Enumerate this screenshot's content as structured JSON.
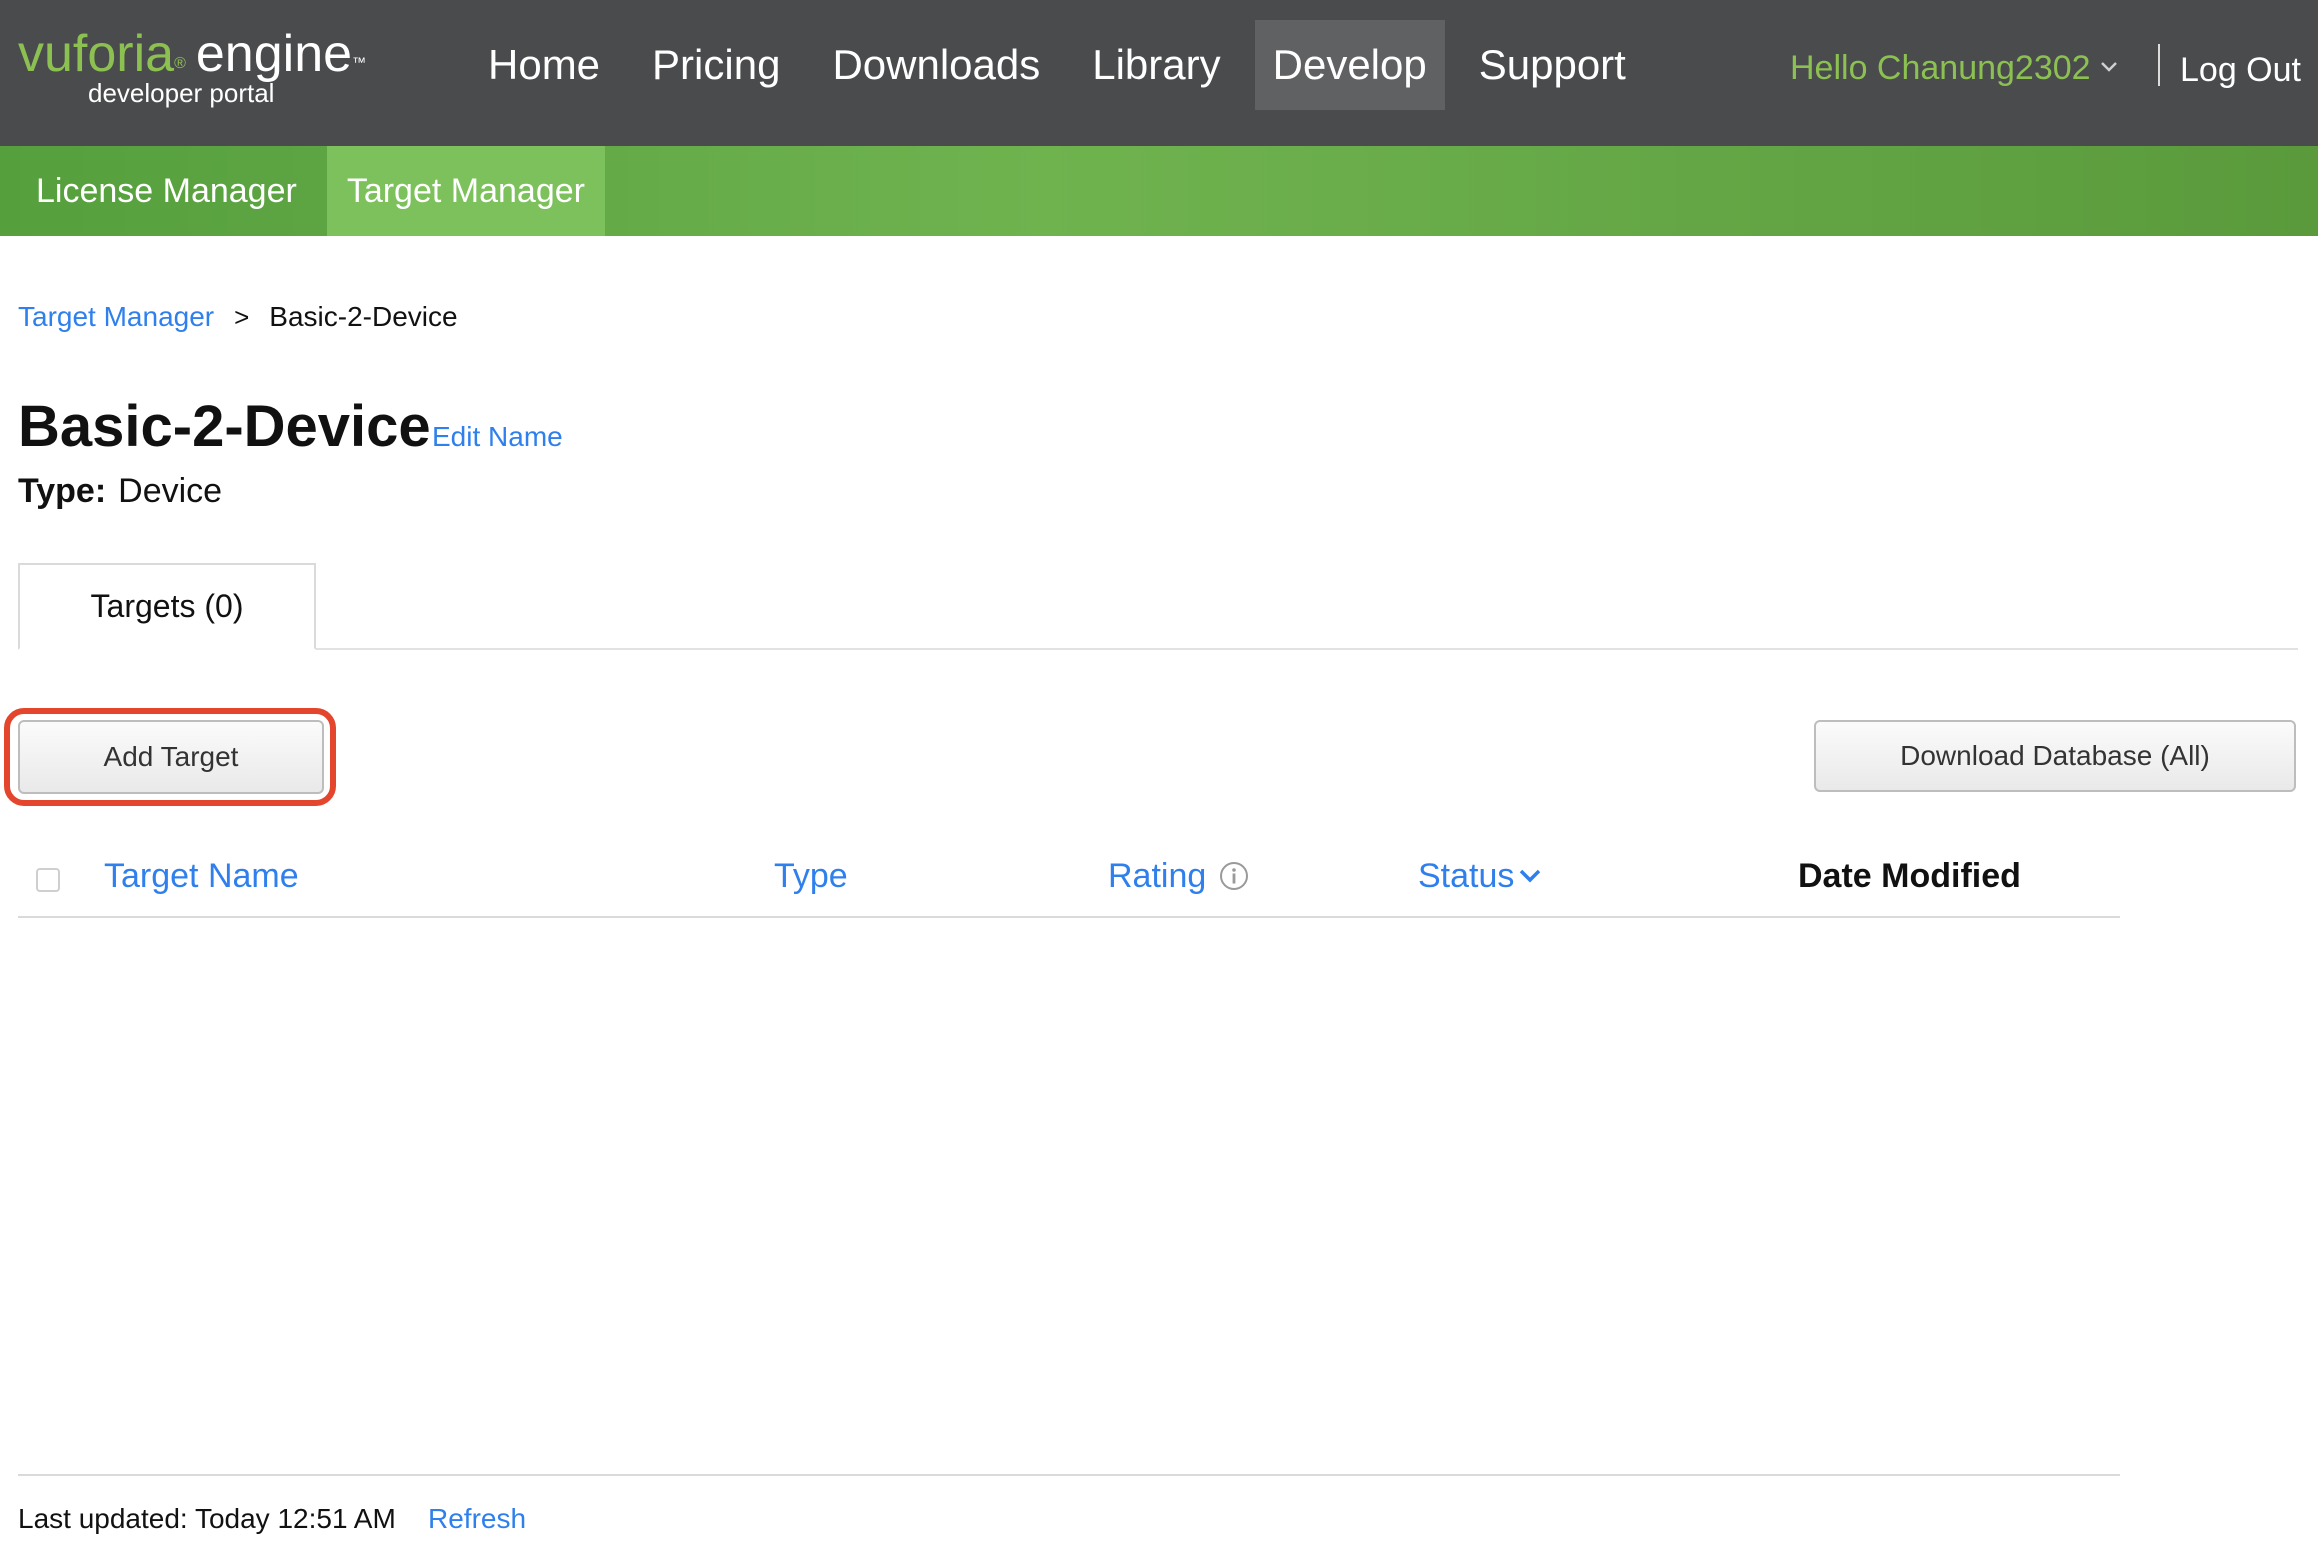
{
  "logo": {
    "brand": "vuforia",
    "registered": "®",
    "product": "engine",
    "trademark": "™",
    "subtitle": "developer portal"
  },
  "main_nav": {
    "items": [
      {
        "label": "Home",
        "active": false
      },
      {
        "label": "Pricing",
        "active": false
      },
      {
        "label": "Downloads",
        "active": false
      },
      {
        "label": "Library",
        "active": false
      },
      {
        "label": "Develop",
        "active": true
      },
      {
        "label": "Support",
        "active": false
      }
    ]
  },
  "user": {
    "greeting": "Hello Chanung2302",
    "logout_label": "Log Out"
  },
  "sub_nav": {
    "items": [
      {
        "label": "License Manager",
        "active": false
      },
      {
        "label": "Target Manager",
        "active": true
      }
    ]
  },
  "breadcrumb": {
    "root": "Target Manager",
    "separator": ">",
    "current": "Basic-2-Device"
  },
  "database": {
    "name": "Basic-2-Device",
    "edit_label": "Edit Name",
    "type_label": "Type:",
    "type_value": "Device"
  },
  "tabs": [
    {
      "label": "Targets (0)",
      "active": true
    }
  ],
  "actions": {
    "add_target_label": "Add Target",
    "download_label": "Download Database (All)"
  },
  "table": {
    "columns": {
      "name": "Target Name",
      "type": "Type",
      "rating": "Rating",
      "status": "Status",
      "date_modified": "Date Modified"
    },
    "rows": []
  },
  "footer": {
    "last_updated": "Last updated: Today 12:51 AM",
    "refresh_label": "Refresh"
  },
  "colors": {
    "topbar": "#4a4b4d",
    "brand_green": "#8cc152",
    "subnav_green": "#6fb34f",
    "link_blue": "#2f80ed",
    "highlight_red": "#e3452d"
  },
  "icons": {
    "user_menu": "chevron-down-icon",
    "rating_info": "info-icon",
    "status_sort": "chevron-down-icon"
  }
}
